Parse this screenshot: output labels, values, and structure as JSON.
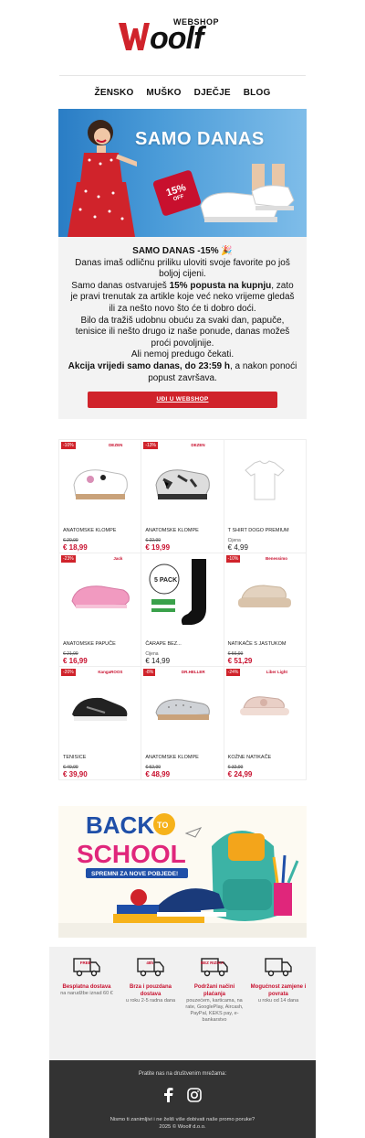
{
  "brand": {
    "small": "WEBSHOP",
    "main": "oolf"
  },
  "nav": [
    "ŽENSKO",
    "MUŠKO",
    "DJEČJE",
    "BLOG"
  ],
  "hero": {
    "title": "SAMO DANAS",
    "tag_value": "15%",
    "tag_sub": "OFF"
  },
  "promo": {
    "heading": "SAMO DANAS -15% 🎉",
    "p1": "Danas imaš odličnu priliku uloviti svoje favorite po još boljoj cijeni.",
    "p2a": "Samo danas ostvaruješ ",
    "p2b": "15% popusta na kupnju",
    "p2c": ", zato je pravi trenutak za artikle koje već neko vrijeme gledaš ili za nešto novo što će ti dobro doći.",
    "p3": "Bilo da tražiš udobnu obuću za svaki dan, papuče, tenisice ili nešto drugo iz naše ponude, danas možeš proći povoljnije.",
    "p4": "Ali nemoj predugo čekati.",
    "p5a": "Akcija vrijedi samo danas, do 23:59 h",
    "p5b": ", a nakon ponoći popust završava.",
    "cta": "UĐI U WEBSHOP"
  },
  "products": [
    {
      "badge": "-10%",
      "brand": "DEZEN",
      "name": "ANATOMSKE KLOMPE",
      "old": "€ 20,99",
      "new": "€ 18,99",
      "img": "clog-white"
    },
    {
      "badge": "-13%",
      "brand": "DEZEN",
      "name": "ANATOMSKE KLOMPE",
      "old": "€ 22,99",
      "new": "€ 19,99",
      "img": "clog-pattern"
    },
    {
      "badge": "",
      "brand": "",
      "name": "T SHIRT DOGO PREMIUM",
      "label": "Cijena",
      "price": "€ 4,99",
      "img": "tshirt"
    },
    {
      "badge": "-23%",
      "brand": "Jack",
      "name": "ANATOMSKE PAPUČE",
      "old": "€ 21,99",
      "new": "€ 16,99",
      "img": "slipper-pink"
    },
    {
      "badge": "",
      "brand": "",
      "name": "ČARAPE BEZ...",
      "label": "Cijena",
      "price": "€ 14,99",
      "img": "socks"
    },
    {
      "badge": "-10%",
      "brand": "Benessimo",
      "name": "NATIKAČE S JASTUKOM",
      "old": "€ 56,99",
      "new": "€ 51,29",
      "img": "sandal-beige"
    },
    {
      "badge": "-20%",
      "brand": "KangaROOS",
      "name": "TENISICE",
      "old": "€ 49,99",
      "new": "€ 39,90",
      "img": "sneaker-black"
    },
    {
      "badge": "-8%",
      "brand": "DR.HELLER",
      "name": "ANATOMSKE KLOMPE",
      "old": "€ 52,99",
      "new": "€ 48,99",
      "img": "clog-silver"
    },
    {
      "badge": "-24%",
      "brand": "Liber Light",
      "name": "KOŽNE NATIKAČE",
      "old": "€ 32,99",
      "new": "€ 24,99",
      "img": "slide-pink"
    }
  ],
  "bts": {
    "line1": "BACK",
    "to": "TO",
    "line2": "SCHOOL",
    "sub": "SPREMNI ZA NOVE POBJEDE!"
  },
  "features": [
    {
      "icon": "truck-free-icon",
      "icon_text": "FREE",
      "title": "Besplatna dostava",
      "text": "na narudžbe iznad 60 €"
    },
    {
      "icon": "truck-48h-icon",
      "icon_text": "48h",
      "title": "Brza i pouzdana dostava",
      "text": "u roku 2-5 radna dana"
    },
    {
      "icon": "return-risk-icon",
      "icon_text": "BEZ RIZIKA",
      "title": "Podržani načini plaćanja",
      "text": "pouzećem, karticama, na rate, GooglePlay, Aircash, PayPal, KEKS pay, e-bankarstvo"
    },
    {
      "icon": "exchange-icon",
      "icon_text": "",
      "title": "Mogućnost zamjene i povrata",
      "text": "u roku od 14 dana"
    }
  ],
  "footer": {
    "follow": "Pratite nas na društvenim mrežama:",
    "unsub": "Nismo ti zanimljivi i ne želiš više dobivati naše promo poruke?",
    "copy": "2025 © Woolf d.o.o."
  },
  "colors": {
    "accent": "#d0232b",
    "footer": "#333333"
  }
}
